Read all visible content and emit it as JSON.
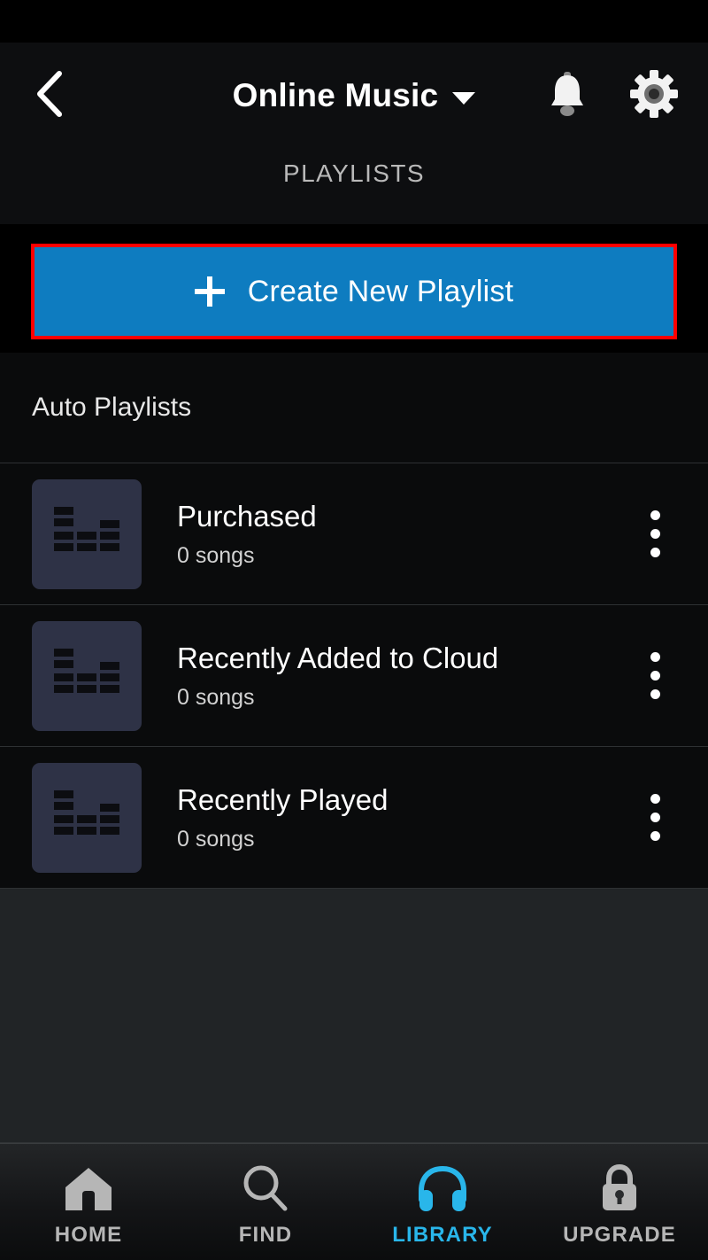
{
  "app": {
    "statusbar": ""
  },
  "header": {
    "back_icon": "chevron-left-icon",
    "title": "Online Music",
    "dropdown_icon": "chevron-down-icon",
    "notification_icon": "bell-icon",
    "settings_icon": "gear-icon",
    "tab": "PLAYLISTS"
  },
  "create": {
    "icon": "plus-icon",
    "label": "Create New Playlist",
    "highlight_color": "#ff0000",
    "button_color": "#0e7cc0"
  },
  "section": {
    "title": "Auto Playlists"
  },
  "playlists": [
    {
      "thumb_icon": "equalizer-bars-icon",
      "title": "Purchased",
      "subtitle": "0 songs",
      "menu_icon": "more-vertical-icon"
    },
    {
      "thumb_icon": "equalizer-bars-icon",
      "title": "Recently Added to Cloud",
      "subtitle": "0 songs",
      "menu_icon": "more-vertical-icon"
    },
    {
      "thumb_icon": "equalizer-bars-icon",
      "title": "Recently Played",
      "subtitle": "0 songs",
      "menu_icon": "more-vertical-icon"
    }
  ],
  "bottom_nav": {
    "active_color": "#29b6ea",
    "inactive_color": "#b6b6b6",
    "items": [
      {
        "icon": "home-icon",
        "label": "HOME",
        "active": false
      },
      {
        "icon": "search-icon",
        "label": "FIND",
        "active": false
      },
      {
        "icon": "headphones-icon",
        "label": "LIBRARY",
        "active": true
      },
      {
        "icon": "lock-icon",
        "label": "UPGRADE",
        "active": false
      }
    ]
  }
}
